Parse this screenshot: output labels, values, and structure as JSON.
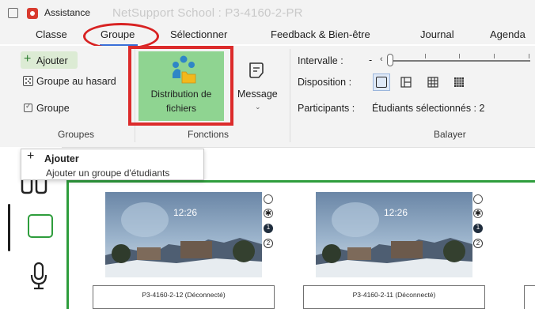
{
  "titlebar": {
    "app_name": "Assistance",
    "document_title": "NetSupport School : P3-4160-2-PR"
  },
  "ribbon_tabs": [
    "Classe",
    "Groupe",
    "Sélectionner",
    "Feedback & Bien-être",
    "Journal",
    "Agenda"
  ],
  "active_tab": "Groupe",
  "groups_section": {
    "add_label": "Ajouter",
    "random_label": "Groupe au hasard",
    "group_label": "Groupe",
    "section_label": "Groupes"
  },
  "functions_section": {
    "distribution_line1": "Distribution de",
    "distribution_line2": "fichiers",
    "message_label": "Message",
    "section_label": "Fonctions"
  },
  "scan_section": {
    "interval_label": "Intervalle :",
    "slider_minus": "-",
    "layout_label": "Disposition :",
    "participants_label": "Participants :",
    "participants_value": "Étudiants sélectionnés : 2",
    "section_label": "Balayer"
  },
  "tooltip": {
    "title": "Ajouter",
    "description": "Ajouter un groupe d'étudiants"
  },
  "students": [
    {
      "time": "12:26",
      "name": "P3-4160-2-12 (Déconnecté)",
      "badge1": "1",
      "badge2": "2"
    },
    {
      "time": "12:26",
      "name": "P3-4160-2-11 (Déconnecté)",
      "badge1": "1",
      "badge2": "2"
    }
  ],
  "colors": {
    "accent_green": "#2e9d3c",
    "highlight_red": "#dc2b2b",
    "distribution_bg": "#8fd491",
    "tab_underline": "#3a6fd8"
  }
}
